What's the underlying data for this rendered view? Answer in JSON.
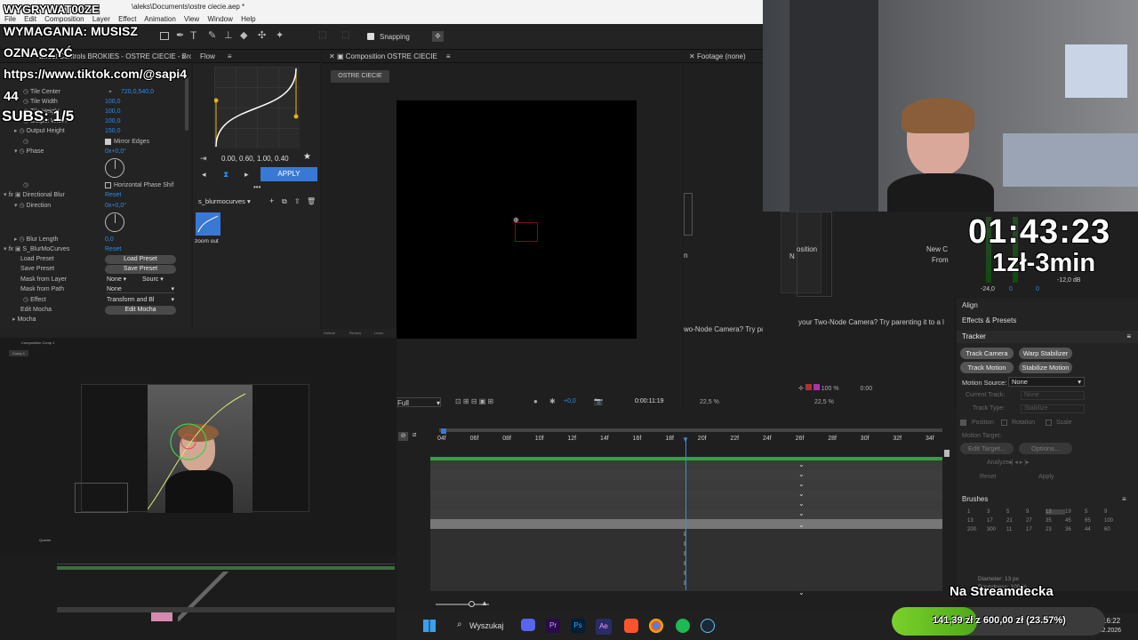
{
  "window": {
    "title": "\\aleks\\Documents\\ostre ciecie.aep *"
  },
  "menu": [
    "File",
    "Edit",
    "Composition",
    "Layer",
    "Effect",
    "Animation",
    "View",
    "Window",
    "Help"
  ],
  "toolbar": {
    "snapping": "Snapping"
  },
  "overlay": {
    "line1": "WYGRYWAT00ZE",
    "line2": "WYMAGANIA: MUSISZ",
    "line3": "OZNACZYĆ",
    "url": "https://www.tiktok.com/@sapi4",
    "n": "44",
    "subs": "SUBS: 1/5",
    "timer": "01:43:23",
    "price": "1zł-3min",
    "streamdeck": "Na Streamdecka",
    "donate": "141,39 zł z 600,00 zł (23.57%)"
  },
  "effect_controls": {
    "tab": "Effect Controls BROKIES - OSTRE CIECIE - Brokie",
    "rows": [
      {
        "label": "Tile Center",
        "value": "720,0,540,0"
      },
      {
        "label": "Tile Width",
        "value": "100,0"
      },
      {
        "label": "Tile Height",
        "value": "100,0"
      },
      {
        "label": "Output Width",
        "value": "100,0"
      },
      {
        "label": "Output Height",
        "value": "150,0"
      },
      {
        "label": "Mirror Edges",
        "value": "Mirror Edges"
      },
      {
        "label": "Phase",
        "value": "0x+0,0°"
      },
      {
        "label": "Horizontal Phase Shift",
        "value": "Horizontal Phase Shif"
      },
      {
        "label": "Directional Blur",
        "value": "Reset"
      },
      {
        "label": "Direction",
        "value": "0x+0,0°"
      },
      {
        "label": "Blur Length",
        "value": "0,0"
      },
      {
        "label": "S_BlurMoCurves",
        "value": "Reset"
      },
      {
        "label": "Load Preset",
        "value": "Load Preset"
      },
      {
        "label": "Save Preset",
        "value": "Save Preset"
      },
      {
        "label": "Mask from Layer",
        "value": "None"
      },
      {
        "label": "Mask from Path",
        "value": "None"
      },
      {
        "label": "Effect",
        "value": "Transform and Bl"
      },
      {
        "label": "Edit Mocha",
        "value": "Edit Mocha"
      },
      {
        "label": "Mocha",
        "value": ""
      }
    ],
    "source": "Sourc",
    "reset": "Reset"
  },
  "flow": {
    "tab": "Flow",
    "values": "0.00, 0.60, 1.00, 0.40",
    "apply": "APPLY",
    "preset": "s_blurmocurves",
    "thumb": "zoom out"
  },
  "composition": {
    "tab": "Composition OSTRE CIECIE",
    "subtab": "OSTRE CIECIE",
    "zoom": "Full",
    "exposure": "+0,0",
    "timecode": "0:00:11:19"
  },
  "footage": {
    "tab": "Footage (none)",
    "zoom1": "22,5 %",
    "zoom2": "22,5 %",
    "pct": "100 %",
    "pos": "0:00",
    "text1": "osition",
    "text2": "New C",
    "text3": "From",
    "text4": "n",
    "text5": "N",
    "tip1": "wo-Node Camera? Try parenting i",
    "tip2": "your Two-Node Camera? Try parenting it to a l"
  },
  "timeline": {
    "ticks": [
      "04f",
      "06f",
      "08f",
      "10f",
      "12f",
      "14f",
      "16f",
      "18f",
      "20f",
      "22f",
      "24f",
      "26f",
      "28f",
      "30f",
      "32f",
      "34f"
    ]
  },
  "audio": {
    "db1": "-12,0 dB",
    "v1": "0",
    "v2": "0",
    "v3": "-24,0"
  },
  "right_panels": {
    "align": "Align",
    "effects_presets": "Effects & Presets",
    "tracker": "Tracker",
    "track_camera": "Track Camera",
    "warp_stabilizer": "Warp Stabilizer",
    "track_motion": "Track Motion",
    "stabilize_motion": "Stabilize Motion",
    "motion_source_label": "Motion Source:",
    "motion_source": "None",
    "current_track": "Current Track:",
    "current_track_val": "None",
    "track_type": "Track Type:",
    "track_type_val": "Stabilize",
    "position": "Position",
    "rotation": "Rotation",
    "scale": "Scale",
    "motion_target": "Motion Target:",
    "edit_target": "Edit Target...",
    "options": "Options...",
    "analyze": "Analyze:",
    "reset": "Reset",
    "apply": "Apply",
    "brushes": "Brushes",
    "diameter": "Diameter: 13 px",
    "roundness": "Roundness: 100 %",
    "brush_sizes": [
      "1",
      "3",
      "5",
      "9",
      "13",
      "19",
      "5",
      "9",
      "13",
      "17",
      "21",
      "27",
      "35",
      "45",
      "65",
      "100",
      "200",
      "300",
      "11",
      "17",
      "23",
      "36",
      "44",
      "60"
    ]
  },
  "taskbar": {
    "search": "Wyszukaj",
    "time": "16:22",
    "date": "24.02.2026"
  },
  "nested": {
    "tab": "Composition Comp 1",
    "sub": "Comp 1",
    "zoom": "Quarter",
    "btn1": "Default",
    "btn2": "Review",
    "btn3": "Learn"
  }
}
